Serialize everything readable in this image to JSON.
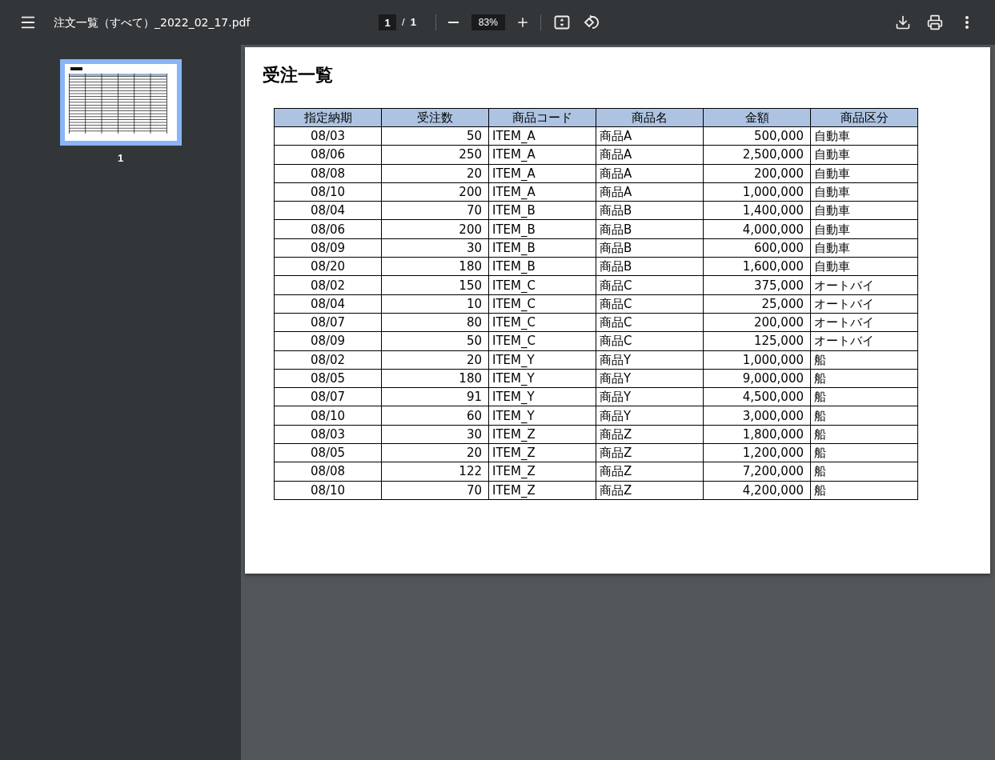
{
  "toolbar": {
    "file_name": "注文一覧（すべて）_2022_02_17.pdf",
    "page_input": "1",
    "page_separator": "/",
    "page_total": "1",
    "zoom": "83%"
  },
  "sidebar": {
    "thumbnails": [
      {
        "label": "1",
        "selected": true,
        "kind": "picture"
      }
    ]
  },
  "document": {
    "title": "受注一覧",
    "table": {
      "columns": [
        {
          "label": "指定納期",
          "kind": "date"
        },
        {
          "label": "受注数",
          "kind": "number"
        },
        {
          "label": "商品コード",
          "kind": "text"
        },
        {
          "label": "商品名",
          "kind": "text"
        },
        {
          "label": "金額",
          "kind": "number"
        },
        {
          "label": "商品区分",
          "kind": "text"
        }
      ],
      "rows": [
        [
          "08/03",
          "50",
          "ITEM_A",
          "商品A",
          "500,000",
          "自動車"
        ],
        [
          "08/06",
          "250",
          "ITEM_A",
          "商品A",
          "2,500,000",
          "自動車"
        ],
        [
          "08/08",
          "20",
          "ITEM_A",
          "商品A",
          "200,000",
          "自動車"
        ],
        [
          "08/10",
          "200",
          "ITEM_A",
          "商品A",
          "1,000,000",
          "自動車"
        ],
        [
          "08/04",
          "70",
          "ITEM_B",
          "商品B",
          "1,400,000",
          "自動車"
        ],
        [
          "08/06",
          "200",
          "ITEM_B",
          "商品B",
          "4,000,000",
          "自動車"
        ],
        [
          "08/09",
          "30",
          "ITEM_B",
          "商品B",
          "600,000",
          "自動車"
        ],
        [
          "08/20",
          "180",
          "ITEM_B",
          "商品B",
          "1,600,000",
          "自動車"
        ],
        [
          "08/02",
          "150",
          "ITEM_C",
          "商品C",
          "375,000",
          "オートバイ"
        ],
        [
          "08/04",
          "10",
          "ITEM_C",
          "商品C",
          "25,000",
          "オートバイ"
        ],
        [
          "08/07",
          "80",
          "ITEM_C",
          "商品C",
          "200,000",
          "オートバイ"
        ],
        [
          "08/09",
          "50",
          "ITEM_C",
          "商品C",
          "125,000",
          "オートバイ"
        ],
        [
          "08/02",
          "20",
          "ITEM_Y",
          "商品Y",
          "1,000,000",
          "船"
        ],
        [
          "08/05",
          "180",
          "ITEM_Y",
          "商品Y",
          "9,000,000",
          "船"
        ],
        [
          "08/07",
          "91",
          "ITEM_Y",
          "商品Y",
          "4,500,000",
          "船"
        ],
        [
          "08/10",
          "60",
          "ITEM_Y",
          "商品Y",
          "3,000,000",
          "船"
        ],
        [
          "08/03",
          "30",
          "ITEM_Z",
          "商品Z",
          "1,800,000",
          "船"
        ],
        [
          "08/05",
          "20",
          "ITEM_Z",
          "商品Z",
          "1,200,000",
          "船"
        ],
        [
          "08/08",
          "122",
          "ITEM_Z",
          "商品Z",
          "7,200,000",
          "船"
        ],
        [
          "08/10",
          "70",
          "ITEM_Z",
          "商品Z",
          "4,200,000",
          "船"
        ]
      ]
    }
  }
}
